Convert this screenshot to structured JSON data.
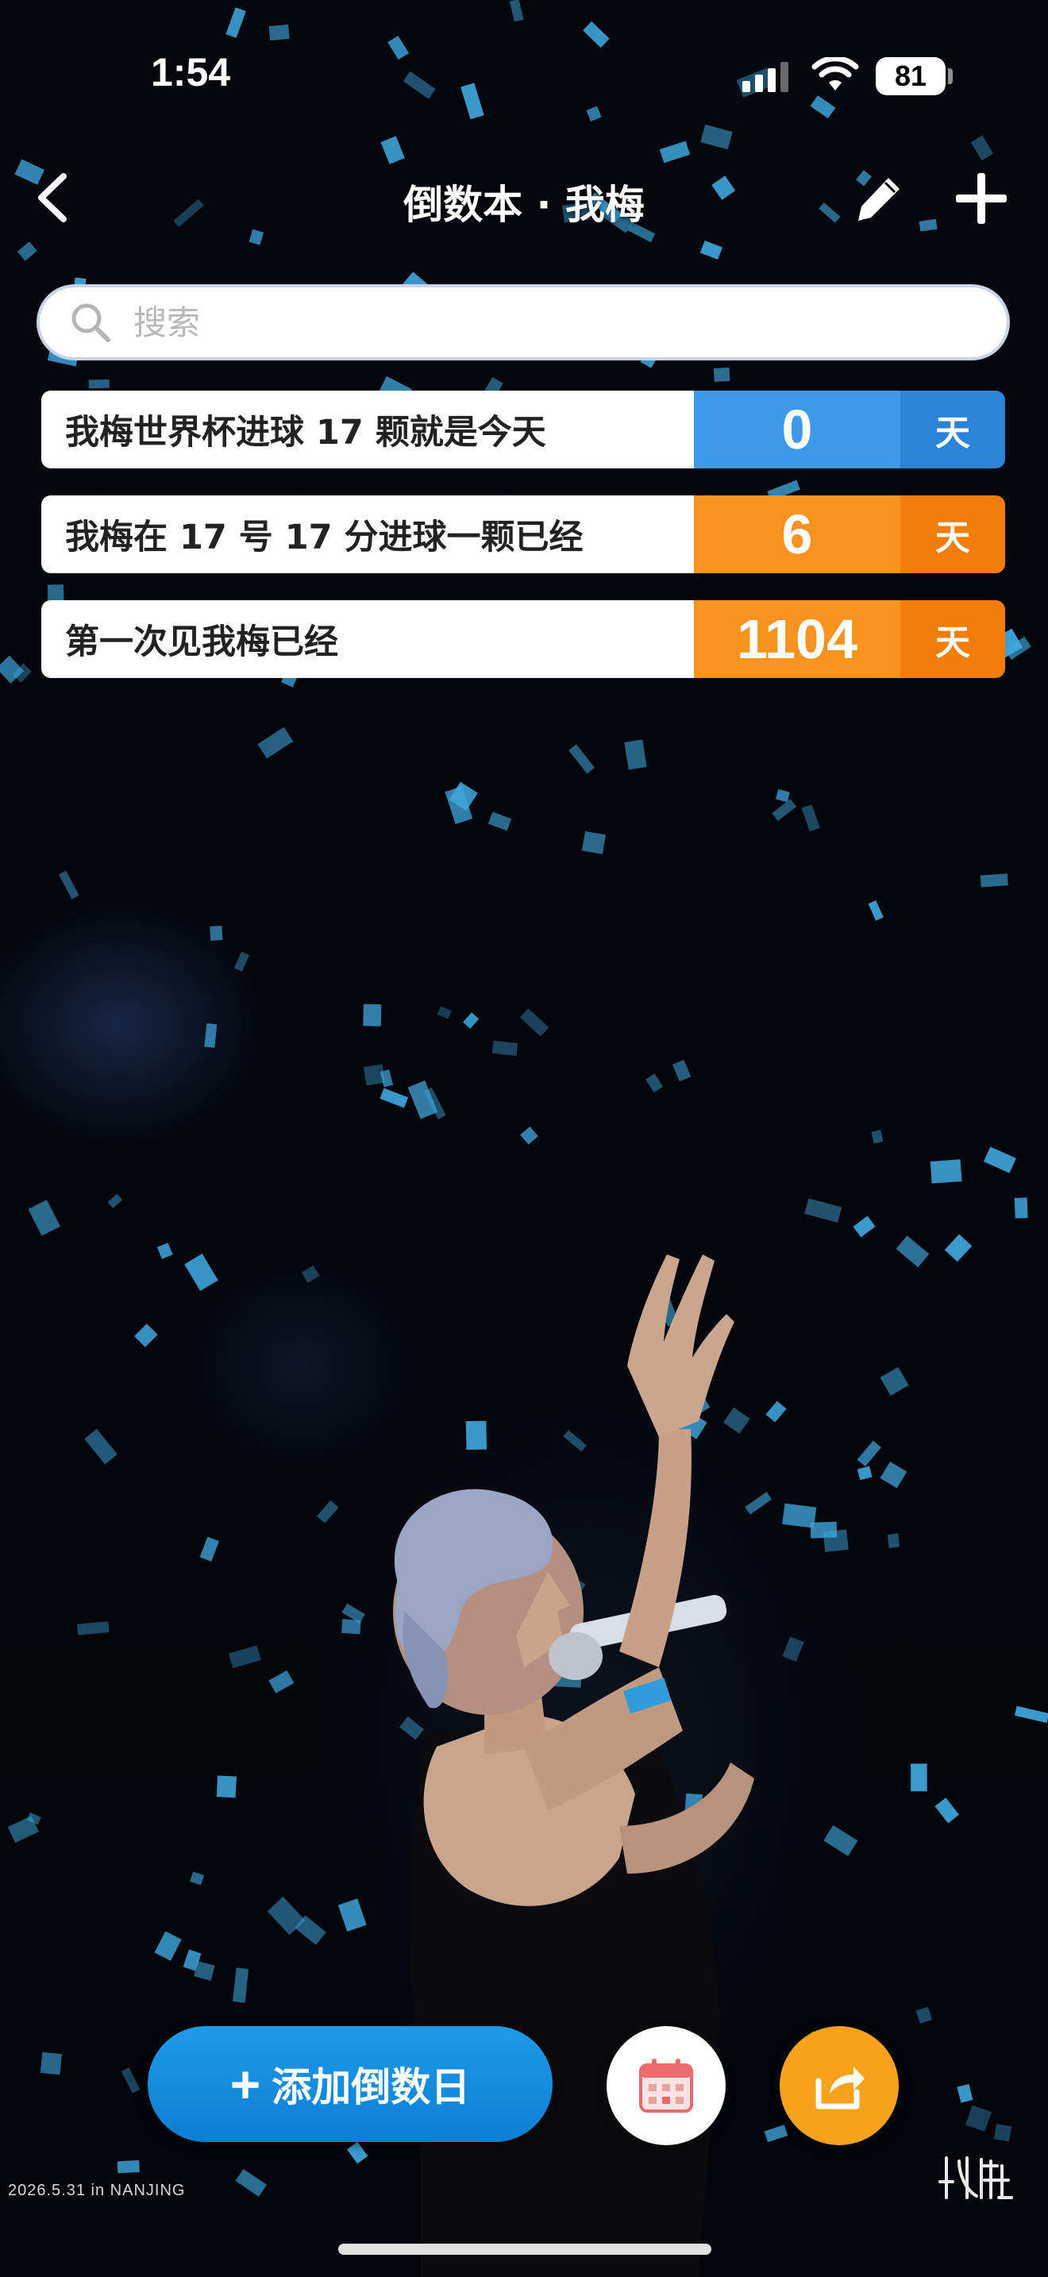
{
  "status_bar": {
    "time": "1:54",
    "battery": "81"
  },
  "nav": {
    "title": "倒数本 · 我梅",
    "back_icon": "chevron-left-icon",
    "edit_icon": "pencil-icon",
    "add_icon": "plus-icon"
  },
  "search": {
    "placeholder": "搜索",
    "value": ""
  },
  "countdowns": [
    {
      "label": "我梅世界杯进球 17 颗就是今天",
      "number": "0",
      "unit": "天",
      "color": "#3d9ae8",
      "unit_color": "#2b84d8"
    },
    {
      "label": "我梅在 17 号 17 分进球一颗已经",
      "number": "6",
      "unit": "天",
      "color": "#f7931e",
      "unit_color": "#f27d0c"
    },
    {
      "label": "第一次见我梅已经",
      "number": "1104",
      "unit": "天",
      "color": "#f7931e",
      "unit_color": "#f27d0c"
    }
  ],
  "actions": {
    "add_label": "添加倒数日",
    "calendar_icon": "calendar-icon",
    "share_icon": "share-icon"
  },
  "photo": {
    "date_caption": "2026.5.31  in  NANJING",
    "watermark": "Ⅱ叶"
  },
  "colors": {
    "accent_blue": "#1f9ae8",
    "accent_orange": "#f7a21a",
    "confetti": "#3fa6dc"
  }
}
